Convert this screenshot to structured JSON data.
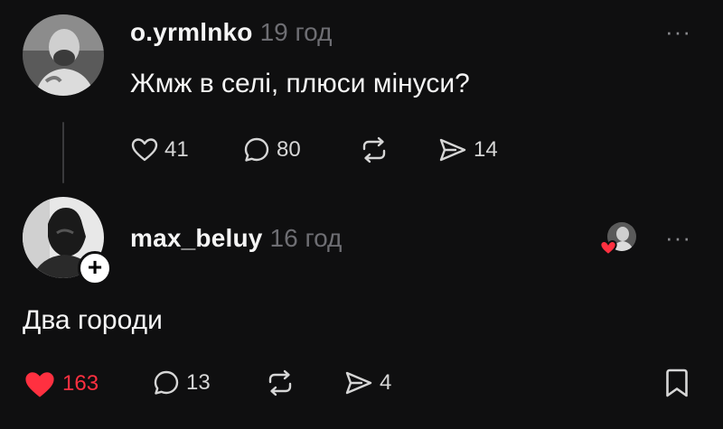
{
  "posts": [
    {
      "username": "o.yrmlnko",
      "time": "19 год",
      "text": "Жмж в селі, плюси мінуси?",
      "likes": "41",
      "comments": "80",
      "shares": "14",
      "more": "···"
    },
    {
      "username": "max_beluy",
      "time": "16 год",
      "text": "Два городи",
      "likes": "163",
      "comments": "13",
      "shares": "4",
      "more": "···",
      "plus": "+"
    }
  ],
  "colors": {
    "background": "#0f0f10",
    "liked": "#ff3040",
    "muted": "#6e6e73",
    "text": "#f5f5f5"
  },
  "icons": [
    "heart-icon",
    "comment-icon",
    "repost-icon",
    "share-icon",
    "bookmark-icon",
    "more-icon",
    "plus-icon"
  ]
}
